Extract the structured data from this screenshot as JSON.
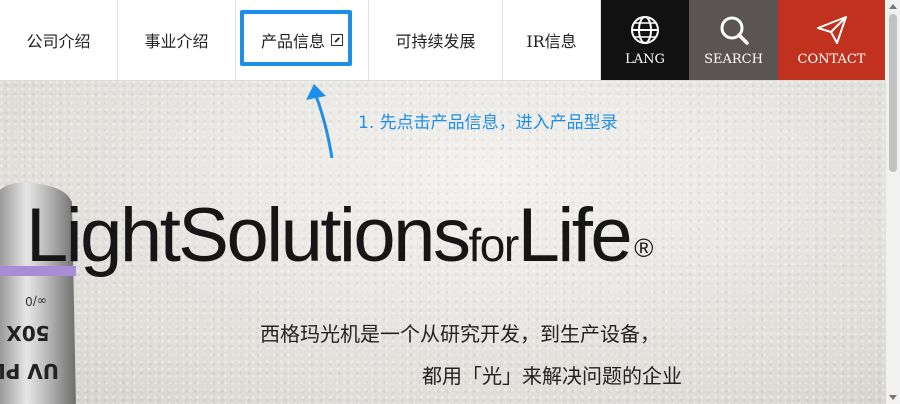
{
  "nav": {
    "items": [
      {
        "label": "公司介绍"
      },
      {
        "label": "事业介绍"
      },
      {
        "label": "产品信息"
      },
      {
        "label": "可持续发展"
      },
      {
        "label": "IR信息"
      }
    ],
    "lang_label": "LANG",
    "search_label": "SEARCH",
    "contact_label": "CONTACT"
  },
  "annotation": {
    "text": "1. 先点击产品信息，进入产品型录",
    "color": "#1e8fe8"
  },
  "hero": {
    "headline_main": "LightSolutions",
    "headline_small": "for",
    "headline_end": "Life",
    "registered_mark": "®",
    "subtitle_line1": "西格玛光机是一个从研究开发，到生产设备，",
    "subtitle_line2": "都用「光」来解决问题的企业",
    "lens_text_top": "∞/0",
    "lens_text_mid": "50X",
    "lens_text_bottom": "UV PL"
  },
  "colors": {
    "lang_bg": "#111111",
    "search_bg": "#5a5452",
    "contact_bg": "#c0321e",
    "highlight": "#1e8fe8"
  }
}
